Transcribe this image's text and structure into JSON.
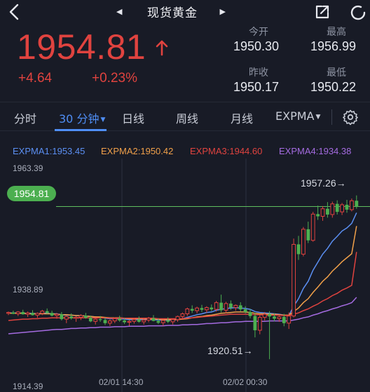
{
  "header": {
    "title": "现货黄金",
    "prev_arrow": "◀",
    "next_arrow": "▶",
    "icons": [
      "back-icon",
      "share-icon",
      "refresh-icon"
    ]
  },
  "quote": {
    "price": "1954.81",
    "change": "+4.64",
    "change_pct": "+0.23%",
    "direction_icon": "up-arrow-icon",
    "color_up": "#e0433f",
    "stats": {
      "open_label": "今开",
      "open": "1950.30",
      "high_label": "最高",
      "high": "1956.99",
      "prev_close_label": "昨收",
      "prev_close": "1950.17",
      "low_label": "最低",
      "low": "1950.22"
    }
  },
  "tabs": [
    {
      "label": "分时"
    },
    {
      "label": "30 分钟",
      "active": true,
      "dropdown": true
    },
    {
      "label": "日线"
    },
    {
      "label": "周线"
    },
    {
      "label": "月线"
    },
    {
      "label": "EXPMA",
      "dropdown": true
    }
  ],
  "accent_color": "#4f8ef5",
  "legend": [
    {
      "label": "EXPMA1:1953.45",
      "color": "#5b8ff2"
    },
    {
      "label": "EXPMA2:1950.42",
      "color": "#f0a04a"
    },
    {
      "label": "EXPMA3:1944.60",
      "color": "#e0433f"
    },
    {
      "label": "EXPMA4:1934.38",
      "color": "#a46be0"
    }
  ],
  "chart_data": {
    "type": "candlestick",
    "y_ticks": [
      "1963.39",
      "1938.89",
      "1914.39"
    ],
    "ylim": [
      1914.39,
      1963.39
    ],
    "x_ticks": [
      "02/01 14:30",
      "02/02 00:30"
    ],
    "current_price_label": "1954.81",
    "current_price": 1954.81,
    "annotations": [
      {
        "text": "1957.26→",
        "value": 1957.26
      },
      {
        "text": "1920.51→",
        "value": 1920.51
      }
    ],
    "candles": [
      [
        1930.8,
        1931.2,
        1930.4,
        1931.0
      ],
      [
        1931.0,
        1931.4,
        1930.6,
        1930.7
      ],
      [
        1930.7,
        1931.3,
        1930.2,
        1931.1
      ],
      [
        1931.1,
        1931.6,
        1930.5,
        1930.6
      ],
      [
        1930.6,
        1931.2,
        1930.0,
        1930.9
      ],
      [
        1930.9,
        1931.5,
        1930.3,
        1930.4
      ],
      [
        1930.4,
        1931.0,
        1929.8,
        1930.8
      ],
      [
        1930.8,
        1931.6,
        1930.4,
        1931.3
      ],
      [
        1931.3,
        1931.9,
        1930.7,
        1930.9
      ],
      [
        1930.9,
        1931.4,
        1930.1,
        1930.3
      ],
      [
        1930.3,
        1930.9,
        1929.6,
        1930.6
      ],
      [
        1930.6,
        1931.1,
        1929.2,
        1929.5
      ],
      [
        1929.5,
        1930.4,
        1928.6,
        1930.1
      ],
      [
        1930.1,
        1930.8,
        1929.4,
        1929.7
      ],
      [
        1929.7,
        1930.2,
        1928.9,
        1929.9
      ],
      [
        1929.9,
        1930.6,
        1929.3,
        1930.3
      ],
      [
        1930.3,
        1930.9,
        1929.6,
        1929.8
      ],
      [
        1929.8,
        1930.3,
        1928.8,
        1929.0
      ],
      [
        1929.0,
        1929.8,
        1928.3,
        1929.5
      ],
      [
        1929.5,
        1930.2,
        1928.9,
        1929.3
      ],
      [
        1929.3,
        1929.9,
        1928.2,
        1928.6
      ],
      [
        1928.6,
        1929.4,
        1928.0,
        1929.1
      ],
      [
        1929.1,
        1929.9,
        1928.6,
        1929.6
      ],
      [
        1929.6,
        1930.3,
        1928.9,
        1929.2
      ],
      [
        1929.2,
        1929.8,
        1928.4,
        1928.8
      ],
      [
        1928.8,
        1929.3,
        1928.0,
        1929.0
      ],
      [
        1929.0,
        1929.7,
        1928.5,
        1929.4
      ],
      [
        1929.4,
        1930.1,
        1928.7,
        1928.9
      ],
      [
        1928.9,
        1929.6,
        1928.3,
        1929.3
      ],
      [
        1929.3,
        1930.0,
        1928.8,
        1929.7
      ],
      [
        1929.7,
        1930.4,
        1929.0,
        1929.1
      ],
      [
        1929.1,
        1929.7,
        1928.4,
        1928.7
      ],
      [
        1928.7,
        1929.4,
        1928.0,
        1929.2
      ],
      [
        1929.2,
        1929.9,
        1928.6,
        1928.9
      ],
      [
        1928.9,
        1929.5,
        1928.3,
        1929.4
      ],
      [
        1929.4,
        1930.3,
        1928.9,
        1930.1
      ],
      [
        1930.1,
        1931.0,
        1929.6,
        1930.7
      ],
      [
        1930.7,
        1932.1,
        1930.2,
        1931.8
      ],
      [
        1931.8,
        1932.6,
        1930.9,
        1931.4
      ],
      [
        1931.4,
        1932.3,
        1930.8,
        1932.0
      ],
      [
        1932.0,
        1932.7,
        1931.1,
        1931.6
      ],
      [
        1931.6,
        1932.4,
        1930.9,
        1932.1
      ],
      [
        1932.1,
        1932.8,
        1931.3,
        1931.7
      ],
      [
        1931.7,
        1933.6,
        1931.2,
        1933.2
      ],
      [
        1933.2,
        1935.0,
        1931.0,
        1931.5
      ],
      [
        1931.5,
        1933.4,
        1930.8,
        1933.0
      ],
      [
        1933.0,
        1933.7,
        1931.6,
        1932.1
      ],
      [
        1932.1,
        1932.8,
        1931.4,
        1932.6
      ],
      [
        1932.6,
        1933.3,
        1931.2,
        1931.7
      ],
      [
        1931.7,
        1932.4,
        1930.8,
        1931.1
      ],
      [
        1931.1,
        1931.8,
        1929.7,
        1930.2
      ],
      [
        1930.2,
        1930.9,
        1925.4,
        1927.0
      ],
      [
        1927.0,
        1930.6,
        1926.1,
        1929.9
      ],
      [
        1929.9,
        1931.1,
        1929.2,
        1930.6
      ],
      [
        1930.6,
        1931.3,
        1920.5,
        1930.1
      ],
      [
        1930.1,
        1930.8,
        1929.0,
        1929.6
      ],
      [
        1929.6,
        1930.3,
        1928.9,
        1930.0
      ],
      [
        1930.0,
        1930.7,
        1927.9,
        1928.6
      ],
      [
        1928.6,
        1931.0,
        1927.3,
        1930.2
      ],
      [
        1930.2,
        1947.6,
        1929.9,
        1946.3
      ],
      [
        1946.3,
        1948.2,
        1942.8,
        1944.1
      ],
      [
        1944.1,
        1950.2,
        1943.6,
        1949.7
      ],
      [
        1949.7,
        1951.4,
        1946.6,
        1947.2
      ],
      [
        1947.2,
        1953.6,
        1946.9,
        1953.1
      ],
      [
        1953.1,
        1955.0,
        1951.8,
        1952.6
      ],
      [
        1952.6,
        1954.9,
        1951.6,
        1954.3
      ],
      [
        1954.3,
        1955.8,
        1952.3,
        1953.0
      ],
      [
        1953.0,
        1955.9,
        1952.3,
        1955.4
      ],
      [
        1955.4,
        1956.2,
        1953.0,
        1953.6
      ],
      [
        1953.6,
        1955.6,
        1952.9,
        1955.2
      ],
      [
        1955.2,
        1956.3,
        1953.4,
        1954.1
      ],
      [
        1954.1,
        1956.6,
        1953.7,
        1956.1
      ],
      [
        1956.1,
        1957.3,
        1954.3,
        1954.8
      ]
    ],
    "series": [
      {
        "name": "EXPMA1",
        "values": [
          1930.9,
          1930.9,
          1930.9,
          1930.8,
          1930.8,
          1930.8,
          1930.7,
          1930.8,
          1930.8,
          1930.7,
          1930.7,
          1930.5,
          1930.4,
          1930.4,
          1930.3,
          1930.3,
          1930.2,
          1930.1,
          1930.0,
          1929.9,
          1929.7,
          1929.6,
          1929.6,
          1929.6,
          1929.5,
          1929.4,
          1929.4,
          1929.4,
          1929.4,
          1929.4,
          1929.4,
          1929.3,
          1929.3,
          1929.3,
          1929.3,
          1929.4,
          1929.6,
          1929.9,
          1930.2,
          1930.5,
          1930.7,
          1931.0,
          1931.1,
          1931.5,
          1931.7,
          1931.9,
          1932.0,
          1932.1,
          1932.0,
          1931.9,
          1931.7,
          1931.2,
          1931.0,
          1930.9,
          1930.8,
          1930.7,
          1930.6,
          1930.4,
          1930.3,
          1932.4,
          1934.1,
          1936.4,
          1938.0,
          1940.5,
          1942.3,
          1944.1,
          1945.4,
          1947.0,
          1948.1,
          1949.3,
          1950.0,
          1951.0,
          1953.4
        ]
      },
      {
        "name": "EXPMA2",
        "values": [
          1930.8,
          1930.8,
          1930.8,
          1930.8,
          1930.7,
          1930.7,
          1930.7,
          1930.7,
          1930.7,
          1930.7,
          1930.6,
          1930.5,
          1930.5,
          1930.4,
          1930.3,
          1930.3,
          1930.2,
          1930.1,
          1930.0,
          1930.0,
          1929.9,
          1929.8,
          1929.8,
          1929.8,
          1929.7,
          1929.6,
          1929.6,
          1929.6,
          1929.6,
          1929.5,
          1929.5,
          1929.5,
          1929.4,
          1929.4,
          1929.4,
          1929.4,
          1929.5,
          1929.6,
          1929.8,
          1930.0,
          1930.1,
          1930.3,
          1930.4,
          1930.6,
          1930.8,
          1930.9,
          1931.0,
          1931.1,
          1931.1,
          1931.1,
          1931.0,
          1930.8,
          1930.7,
          1930.7,
          1930.6,
          1930.6,
          1930.5,
          1930.4,
          1930.4,
          1931.2,
          1932.0,
          1933.2,
          1934.1,
          1935.5,
          1936.7,
          1938.0,
          1939.0,
          1940.3,
          1941.3,
          1942.4,
          1943.3,
          1944.2,
          1950.4
        ]
      },
      {
        "name": "EXPMA3",
        "values": [
          1929.2,
          1929.3,
          1929.4,
          1929.5,
          1929.5,
          1929.6,
          1929.6,
          1929.7,
          1929.7,
          1929.8,
          1929.8,
          1929.8,
          1929.8,
          1929.8,
          1929.8,
          1929.8,
          1929.8,
          1929.8,
          1929.8,
          1929.8,
          1929.8,
          1929.7,
          1929.7,
          1929.7,
          1929.7,
          1929.7,
          1929.7,
          1929.7,
          1929.7,
          1929.7,
          1929.7,
          1929.6,
          1929.6,
          1929.6,
          1929.6,
          1929.6,
          1929.6,
          1929.7,
          1929.8,
          1929.9,
          1930.0,
          1930.1,
          1930.2,
          1930.3,
          1930.4,
          1930.5,
          1930.6,
          1930.6,
          1930.6,
          1930.6,
          1930.6,
          1930.5,
          1930.5,
          1930.4,
          1930.4,
          1930.4,
          1930.4,
          1930.3,
          1930.3,
          1930.6,
          1930.9,
          1931.4,
          1931.8,
          1932.4,
          1932.9,
          1933.6,
          1934.1,
          1934.8,
          1935.3,
          1936.0,
          1936.5,
          1937.1,
          1944.6
        ]
      },
      {
        "name": "EXPMA4",
        "values": [
          1926.2,
          1926.3,
          1926.4,
          1926.5,
          1926.6,
          1926.7,
          1926.8,
          1926.9,
          1927.0,
          1927.1,
          1927.2,
          1927.2,
          1927.3,
          1927.4,
          1927.4,
          1927.5,
          1927.5,
          1927.6,
          1927.6,
          1927.7,
          1927.7,
          1927.7,
          1927.8,
          1927.8,
          1927.8,
          1927.9,
          1927.9,
          1927.9,
          1927.9,
          1928.0,
          1928.0,
          1928.0,
          1928.0,
          1928.1,
          1928.1,
          1928.1,
          1928.2,
          1928.2,
          1928.3,
          1928.3,
          1928.4,
          1928.5,
          1928.5,
          1928.6,
          1928.7,
          1928.7,
          1928.8,
          1928.9,
          1928.9,
          1929.0,
          1929.0,
          1929.0,
          1929.0,
          1929.0,
          1929.1,
          1929.1,
          1929.1,
          1929.1,
          1929.1,
          1929.3,
          1929.5,
          1929.8,
          1930.0,
          1930.4,
          1930.7,
          1931.1,
          1931.4,
          1931.8,
          1932.1,
          1932.5,
          1932.8,
          1933.2,
          1934.4
        ]
      }
    ],
    "colors": {
      "up": "#e0433f",
      "down": "#4caf50",
      "price_line": "#5fbf5f"
    }
  }
}
